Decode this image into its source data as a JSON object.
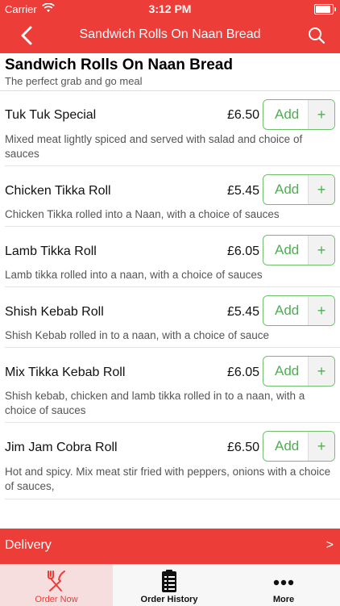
{
  "status_bar": {
    "carrier": "Carrier",
    "time": "3:12 PM",
    "battery_level": 1.0
  },
  "nav": {
    "title": "Sandwich Rolls On Naan Bread",
    "back_icon": "chevron-left-icon",
    "search_icon": "search-icon"
  },
  "section": {
    "title": "Sandwich Rolls On Naan Bread",
    "subtitle": "The perfect grab and go meal"
  },
  "items": [
    {
      "name": "Tuk Tuk Special",
      "price": "£6.50",
      "add_label": "Add",
      "plus": "+",
      "description": "Mixed meat lightly spiced and served with salad and choice of sauces"
    },
    {
      "name": "Chicken Tikka Roll",
      "price": "£5.45",
      "add_label": "Add",
      "plus": "+",
      "description": "Chicken Tikka rolled into a Naan, with a choice of sauces"
    },
    {
      "name": "Lamb Tikka Roll",
      "price": "£6.05",
      "add_label": "Add",
      "plus": "+",
      "description": "Lamb tikka rolled into a naan, with a choice of sauces"
    },
    {
      "name": "Shish Kebab Roll",
      "price": "£5.45",
      "add_label": "Add",
      "plus": "+",
      "description": "Shish Kebab rolled in to a naan, with a choice of sauce"
    },
    {
      "name": "Mix Tikka Kebab Roll",
      "price": "£6.05",
      "add_label": "Add",
      "plus": "+",
      "description": "Shish kebab, chicken and lamb tikka rolled in to a naan, with a choice of sauces"
    },
    {
      "name": "Jim Jam Cobra Roll",
      "price": "£6.50",
      "add_label": "Add",
      "plus": "+",
      "description": "Hot and spicy. Mix meat stir fried with peppers, onions with a choice of sauces,"
    }
  ],
  "delivery": {
    "label": "Delivery",
    "arrow": ">"
  },
  "tabs": [
    {
      "label": "Order Now",
      "icon": "fork-knife-icon",
      "active": true
    },
    {
      "label": "Order History",
      "icon": "clipboard-icon",
      "active": false
    },
    {
      "label": "More",
      "icon": "more-dots-icon",
      "active": false
    }
  ],
  "colors": {
    "brand": "#ec3d39",
    "add_green": "#4caf50"
  }
}
